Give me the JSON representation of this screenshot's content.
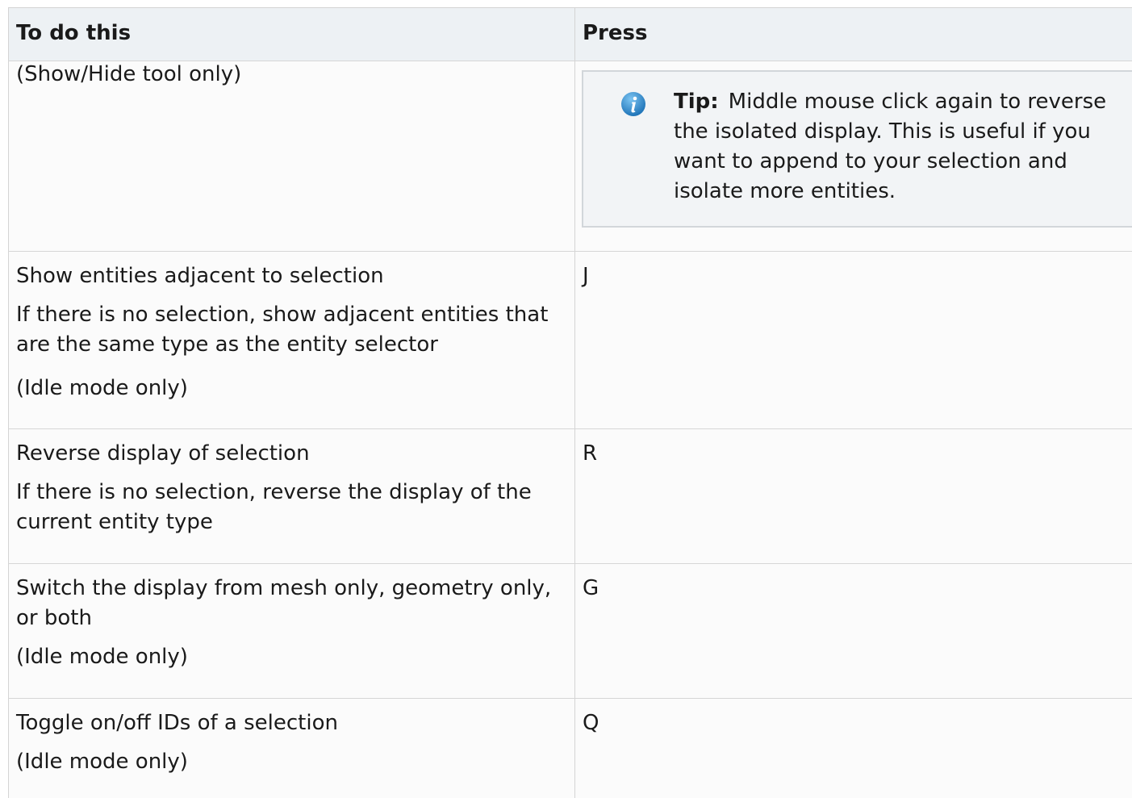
{
  "table": {
    "headers": {
      "action": "To do this",
      "key": "Press"
    },
    "rows": [
      {
        "action_lines": [
          "(Show/Hide tool only)"
        ],
        "tip": {
          "icon": "info-icon",
          "label": "Tip:",
          "text": "Middle mouse click again to reverse the isolated display. This is useful if you want to append to your selection and isolate more entities."
        }
      },
      {
        "action_lines": [
          "Show entities adjacent to selection",
          "If there is no selection, show adjacent entities that are the same type as the entity selector",
          "(Idle mode only)"
        ],
        "key": "J"
      },
      {
        "action_lines": [
          "Reverse display of selection",
          "If there is no selection, reverse the display of the current entity type"
        ],
        "key": "R"
      },
      {
        "action_lines": [
          "Switch the display from mesh only, geometry only, or both",
          "(Idle mode only)"
        ],
        "key": "G"
      },
      {
        "action_lines": [
          "Toggle on/off IDs of a selection",
          "(Idle mode only)"
        ],
        "key": "Q"
      }
    ]
  },
  "colors": {
    "header_bg": "#edf1f4",
    "table_bg": "#fbfbfb",
    "tip_bg": "#f2f4f6",
    "info_icon": "#2a86c8",
    "border": "#d4d4d4"
  }
}
